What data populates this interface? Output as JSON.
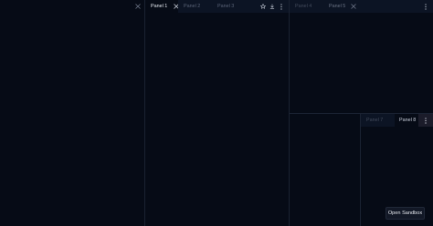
{
  "panel_group_1": {
    "tabs": []
  },
  "panel_group_2": {
    "tabs": [
      {
        "label": "Panel 1",
        "active": true
      },
      {
        "label": "Panel 2",
        "active": false
      },
      {
        "label": "Panel 3",
        "active": false
      }
    ],
    "actions": [
      "star-icon",
      "download-icon",
      "more-vertical-icon"
    ]
  },
  "panel_group_3": {
    "tabs": [
      {
        "label": "Panel 4",
        "active": false
      },
      {
        "label": "Panel 5",
        "active": true
      }
    ],
    "actions": [
      "more-vertical-icon"
    ]
  },
  "panel_group_4": {
    "tabs": [
      {
        "label": "Panel 7",
        "active": false
      },
      {
        "label": "Panel 8",
        "active": true
      }
    ],
    "actions": [
      "more-vertical-icon"
    ]
  },
  "sandbox_button": {
    "label": "Open Sandbox"
  },
  "colors": {
    "background": "#060b16",
    "tab_inactive_bg": "#0c1424",
    "divider": "#1a2232",
    "text_active": "#e7ebf3",
    "text_inactive": "#5b6478",
    "accent_highlight": "#2a1f2a"
  }
}
